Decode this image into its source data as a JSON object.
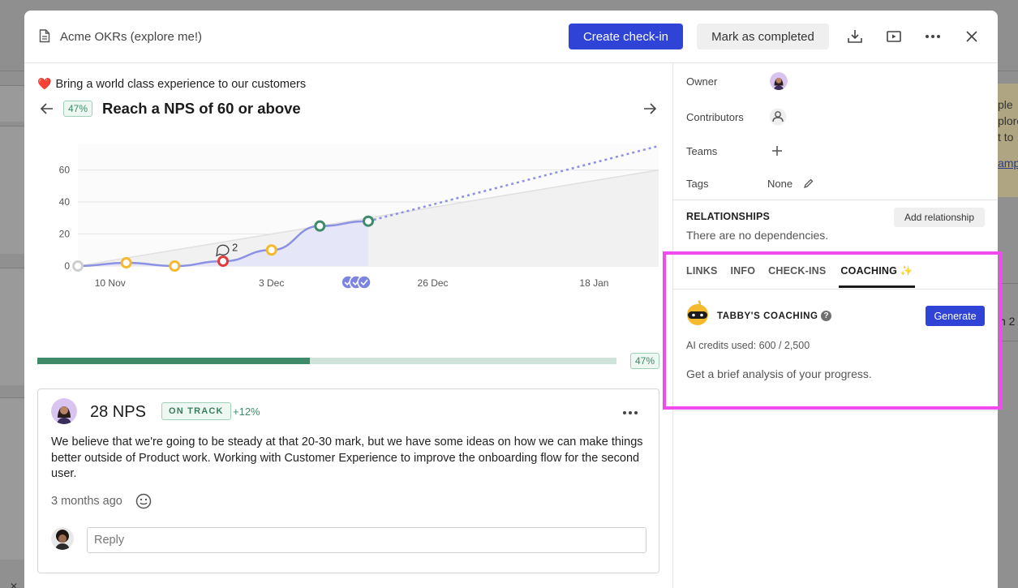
{
  "background": {
    "side_snippets": [
      "ple",
      "plore",
      "t to",
      "amp"
    ],
    "side_right": "n 2"
  },
  "header": {
    "doc_icon": "document-icon",
    "title": "Acme OKRs (explore me!)",
    "create_checkin": "Create check-in",
    "mark_completed": "Mark as completed",
    "icons": [
      "download-icon",
      "present-icon",
      "more-icon",
      "close-icon"
    ]
  },
  "objective": {
    "emoji": "❤️",
    "title": "Bring a world class experience to our customers"
  },
  "key_result": {
    "progress_badge": "47%",
    "title": "Reach a NPS of 60 or above",
    "progress_value": 0.47,
    "progress_label": "47%"
  },
  "chart_data": {
    "type": "line",
    "x_labels": [
      "10 Nov",
      "3 Dec",
      "26 Dec",
      "18 Jan"
    ],
    "y_ticks": [
      0,
      20,
      40,
      60
    ],
    "ylim": [
      0,
      76
    ],
    "actual_points": [
      {
        "x": 0,
        "y": 0,
        "status": "none"
      },
      {
        "x": 12,
        "y": 2,
        "status": "at-risk"
      },
      {
        "x": 24,
        "y": 0,
        "status": "at-risk"
      },
      {
        "x": 36,
        "y": 3,
        "status": "off-track"
      },
      {
        "x": 48,
        "y": 10,
        "status": "at-risk"
      },
      {
        "x": 60,
        "y": 25,
        "status": "on-track"
      },
      {
        "x": 72,
        "y": 28,
        "status": "on-track"
      }
    ],
    "forecast_end": {
      "x": 144,
      "y": 75
    },
    "target_line": {
      "start": 0,
      "end": 60
    },
    "x_tick_positions": [
      8,
      48,
      88,
      128
    ],
    "x_max": 144,
    "comment_count": "2",
    "comment_at": {
      "x": 36,
      "y": 12
    },
    "checkin_markers_x": [
      67,
      69,
      71
    ]
  },
  "checkin": {
    "value": "28 NPS",
    "status": "ON TRACK",
    "delta": "+12%",
    "body": "We believe that we're going to be steady at that 20-30 mark, but we have some ideas on how we can make things better outside of Product work. Working with Customer Experience to improve the onboarding flow for the second user.",
    "time": "3 months ago",
    "reply_placeholder": "Reply"
  },
  "details": {
    "owner_label": "Owner",
    "contributors_label": "Contributors",
    "teams_label": "Teams",
    "tags_label": "Tags",
    "tags_value": "None"
  },
  "relationships": {
    "title": "RELATIONSHIPS",
    "add_label": "Add relationship",
    "empty_text": "There are no dependencies."
  },
  "tabs": [
    {
      "label": "LINKS"
    },
    {
      "label": "INFO"
    },
    {
      "label": "CHECK-INS"
    },
    {
      "label": "COACHING ✨"
    }
  ],
  "coaching": {
    "title": "TABBY'S COACHING",
    "generate": "Generate",
    "credits": "AI credits used: 600 / 2,500",
    "description": "Get a brief analysis of your progress."
  },
  "colors": {
    "primary": "#2f44d6",
    "on_track": "#3e8a69",
    "at_risk": "#f4b92c",
    "off_track": "#e23b3b",
    "line": "#8b91e3",
    "highlight": "#ef4bef"
  }
}
